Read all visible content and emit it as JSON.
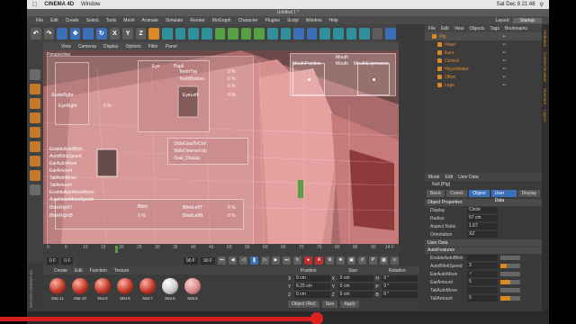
{
  "mac_menu": {
    "app": "CINEMA 4D",
    "window": "Window",
    "clock": "Sat Dec 8  21:48"
  },
  "window_title": "Untitled 1 *",
  "c4d_menu": [
    "File",
    "Edit",
    "Create",
    "Select",
    "Tools",
    "Mesh",
    "Animate",
    "Simulate",
    "Render",
    "MoGraph",
    "Character",
    "Plugins",
    "Script",
    "Window",
    "Help"
  ],
  "layout": {
    "label": "Layout:",
    "value": "Startup"
  },
  "toolbar": [
    "↶",
    "↷",
    "",
    "✥",
    "",
    "↻",
    "X",
    "Y",
    "Z",
    "",
    "",
    "",
    "",
    "",
    "",
    "",
    "",
    "",
    "",
    "",
    "",
    "",
    "",
    "",
    "",
    "",
    "",
    ""
  ],
  "viewport": {
    "menu": [
      "View",
      "Cameras",
      "Display",
      "Options",
      "Filter",
      "Panel"
    ],
    "label": "Perspective"
  },
  "overlay": {
    "labels": [
      "ScaleRight",
      "EyeRight",
      "Eye",
      "Pupil",
      "TeethTop",
      "TeethBottom",
      "EyeLeft",
      "EnableAutoBlink",
      "AutoBlinkSpeed",
      "EarAutoMove",
      "EarAmount",
      "TailAutoMove",
      "TailAmount",
      "EnableAutoNoseMove",
      "AutoNoseMoveSpeed",
      "BlinkRightT",
      "BlinkRightB",
      "Blink",
      "BlinkLeftT",
      "BlinkLeftB",
      "SlideGoalToCntl",
      "SlideDownsetUp",
      "Goal_Display"
    ],
    "values": [
      "0 %",
      "0 %",
      "0 %",
      "0 %",
      "0 %",
      "0 %",
      "0 %",
      "0 %"
    ]
  },
  "mouth_panel": {
    "title": "Mouth",
    "labels": [
      "MouthPosition",
      "Mouth",
      "MouthExpression"
    ]
  },
  "timeline": {
    "ticks": [
      "0",
      "5",
      "10",
      "15",
      "20",
      "25",
      "30",
      "35",
      "40",
      "45",
      "50",
      "55",
      "60",
      "65",
      "70",
      "75",
      "80",
      "85",
      "90"
    ],
    "end": "14 F"
  },
  "playback": {
    "start": "0 F",
    "frame": "0 F",
    "end": "90 F",
    "fps": "90 F"
  },
  "materials": {
    "menu": [
      "Create",
      "Edit",
      "Function",
      "Texture"
    ],
    "items": [
      {
        "name": "Mat.11",
        "kind": "red"
      },
      {
        "name": "Mat.10",
        "kind": "red"
      },
      {
        "name": "Mat.9",
        "kind": "red"
      },
      {
        "name": "Mat.8",
        "kind": "red"
      },
      {
        "name": "Mat.7",
        "kind": "red"
      },
      {
        "name": "Mat.6",
        "kind": "white"
      },
      {
        "name": "Mat.5",
        "kind": "pink"
      }
    ]
  },
  "coordinates": {
    "headers": [
      "Position",
      "Size",
      "Rotation"
    ],
    "rows": [
      {
        "axis": "X",
        "pos": "0 cm",
        "size": "0 cm",
        "rot_axis": "H",
        "rot": "0 °"
      },
      {
        "axis": "Y",
        "pos": "6.25 cm",
        "size": "0 cm",
        "rot_axis": "P",
        "rot": "0 °"
      },
      {
        "axis": "Z",
        "pos": "0 cm",
        "size": "0 cm",
        "rot_axis": "B",
        "rot": "0 °"
      }
    ],
    "mode": "Object (Rel)",
    "size_mode": "Size",
    "apply": "Apply"
  },
  "object_manager": {
    "menu": [
      "File",
      "Edit",
      "View",
      "Objects",
      "Tags",
      "Bookmarks"
    ],
    "objects": [
      {
        "name": "Pig",
        "sel": true
      },
      {
        "name": "Head",
        "sel": false
      },
      {
        "name": "Ears",
        "sel": false
      },
      {
        "name": "Control",
        "sel": false
      },
      {
        "name": "Heyooktator",
        "sel": false
      },
      {
        "name": "Other",
        "sel": false
      },
      {
        "name": "Legs",
        "sel": false
      }
    ]
  },
  "attributes": {
    "menu": [
      "Mode",
      "Edit",
      "User Data"
    ],
    "title": "Null [Pig]",
    "tabs": [
      {
        "label": "Basic",
        "on": false
      },
      {
        "label": "Coord.",
        "on": false
      },
      {
        "label": "Object",
        "on": true
      },
      {
        "label": "User Data",
        "on": true
      },
      {
        "label": "Display",
        "on": false
      }
    ],
    "section": "Object Properties",
    "props": [
      {
        "label": "Display",
        "value": "Circle"
      },
      {
        "label": "Radius",
        "value": "57 cm"
      },
      {
        "label": "Aspect Ratio",
        "value": "1.67"
      },
      {
        "label": "Orientation",
        "value": "XZ"
      }
    ],
    "user_data_title": "User Data",
    "user_data_group": "AutoFeatures",
    "user_data": [
      {
        "label": "EnableAutoBlink",
        "value": "",
        "fill": 0
      },
      {
        "label": "AutoBlinkSpeed",
        "value": "3",
        "fill": 0.3
      },
      {
        "label": "EarAutoMove",
        "value": "✓",
        "fill": 0
      },
      {
        "label": "EarAmount",
        "value": "5",
        "fill": 0.5
      },
      {
        "label": "TailAutoMove",
        "value": "",
        "fill": 0
      },
      {
        "label": "TailAmount",
        "value": "5",
        "fill": 0.5
      }
    ]
  },
  "right_strip": [
    "Attributes",
    "Content Browser",
    "Structure",
    "Layers"
  ],
  "brand": "MAXON CINEMA 4D",
  "video_progress": 0.55,
  "accent_color": "#d98a22",
  "progress_color": "#d61e1e"
}
